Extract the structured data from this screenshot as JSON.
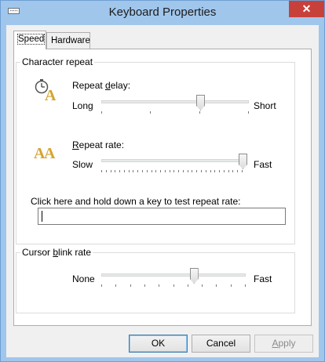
{
  "window": {
    "title": "Keyboard Properties",
    "close_glyph": "✕"
  },
  "tabs": [
    {
      "label": "Speed",
      "active": true
    },
    {
      "label": "Hardware",
      "active": false
    }
  ],
  "character_repeat": {
    "legend": "Character repeat",
    "repeat_delay": {
      "label_pre": "Repeat ",
      "label_ul": "d",
      "label_post": "elay:",
      "min_label": "Long",
      "max_label": "Short",
      "value_fraction": 0.67,
      "tick_count": 4,
      "icon": "clock-letter-a-icon"
    },
    "repeat_rate": {
      "label_pre": "",
      "label_ul": "R",
      "label_post": "epeat rate:",
      "min_label": "Slow",
      "max_label": "Fast",
      "value_fraction": 1.0,
      "tick_count": 32,
      "icon": "double-letter-a-icon"
    },
    "test": {
      "label": "Click here and hold down a key to test repeat rate:",
      "value": ""
    }
  },
  "cursor_blink": {
    "legend_pre": "Cursor ",
    "legend_ul": "b",
    "legend_post": "link rate",
    "min_label": "None",
    "max_label": "Fast",
    "value_fraction": 0.64,
    "tick_count": 11
  },
  "buttons": {
    "ok": "OK",
    "cancel": "Cancel",
    "apply_ul": "A",
    "apply_rest": "pply"
  },
  "colors": {
    "frame": "#a0c6ec",
    "close": "#c7413a",
    "icon_gold": "#d4a531"
  }
}
